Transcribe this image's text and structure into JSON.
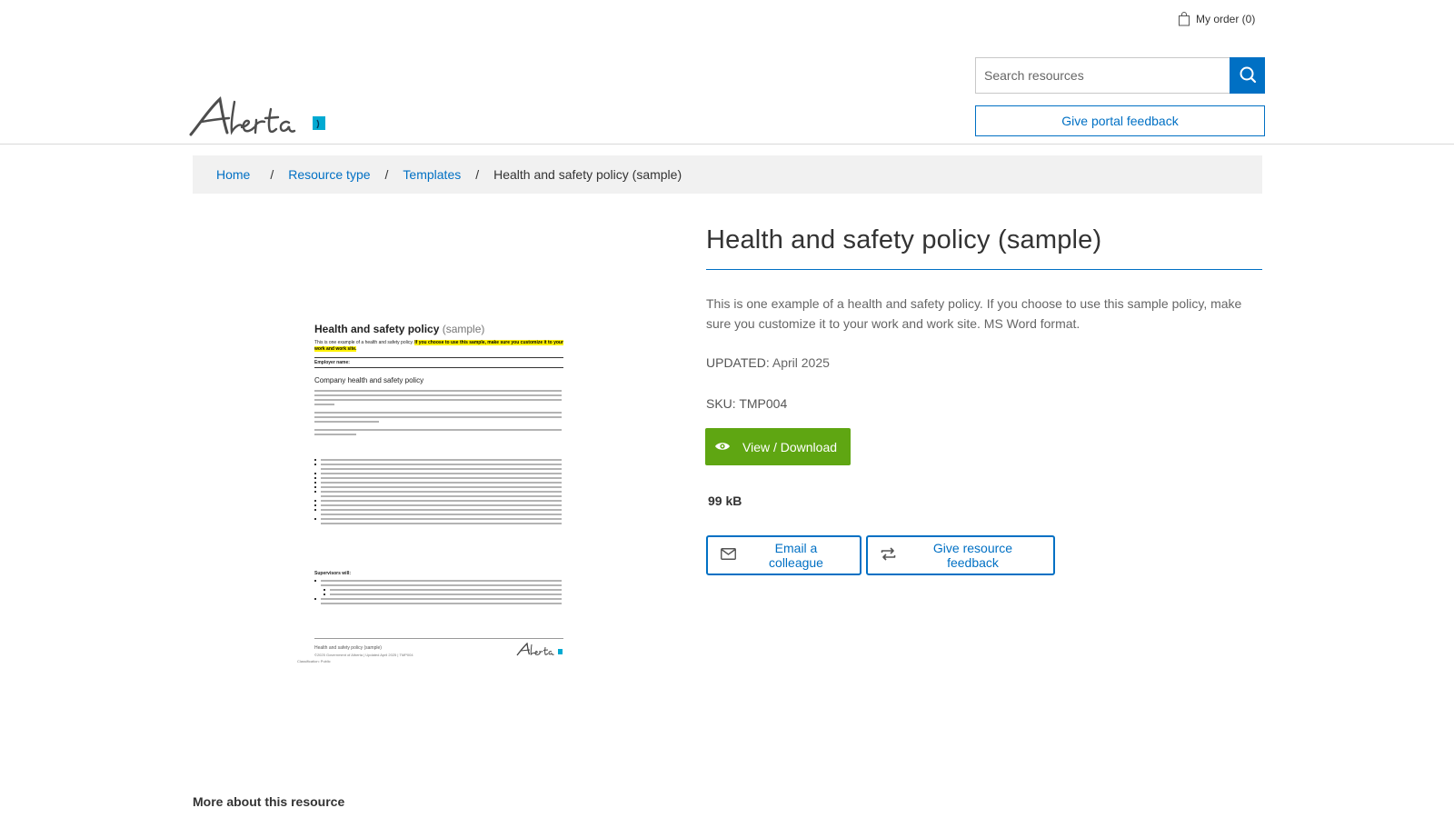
{
  "header": {
    "order_label": "My order (0)",
    "brand_wordmark": "Alberta",
    "search_placeholder": "Search resources",
    "portal_feedback_label": "Give portal feedback"
  },
  "breadcrumb": {
    "home": "Home",
    "separator": "/",
    "resource_type": "Resource type",
    "templates": "Templates",
    "current": "Health and safety policy (sample)"
  },
  "preview": {
    "title_main": "Health and safety policy",
    "title_sub": "(sample)",
    "intro_plain": "This is one example of a health and safety policy.",
    "intro_highlight": "If you choose to use this sample, make sure you customize it to your work and work site.",
    "employer_label": "Employer name:",
    "company_heading": "Company health and safety policy",
    "supervisors_label": "Supervisors will:",
    "footer_title": "Health and safety policy (sample)",
    "footer_meta": "©2025 Government of Alberta  |  Updated April 2025  |  TMP004",
    "footer_class": "Classification: Public"
  },
  "product": {
    "title": "Health and safety policy (sample)",
    "description": "This is one example of a health and safety policy. If you choose to use this sample policy, make sure you customize it to your work and work site. MS Word format.",
    "updated_label": "UPDATED:",
    "updated_value": "April 2025",
    "sku_label": "SKU:",
    "sku_value": "TMP004",
    "view_download_label": "View / Download",
    "file_size": "99 kB",
    "email_colleague_label": "Email a colleague",
    "resource_feedback_label": "Give resource feedback"
  },
  "more_section": {
    "heading": "More about this resource"
  },
  "colors": {
    "link_blue": "#0070c4",
    "action_green": "#5fa612",
    "breadcrumb_bg": "#f1f1f1",
    "logo_teal": "#00aad2"
  },
  "icons": [
    "shopping-bag-icon",
    "search-icon",
    "eye-icon",
    "mail-icon",
    "swap-icon"
  ]
}
